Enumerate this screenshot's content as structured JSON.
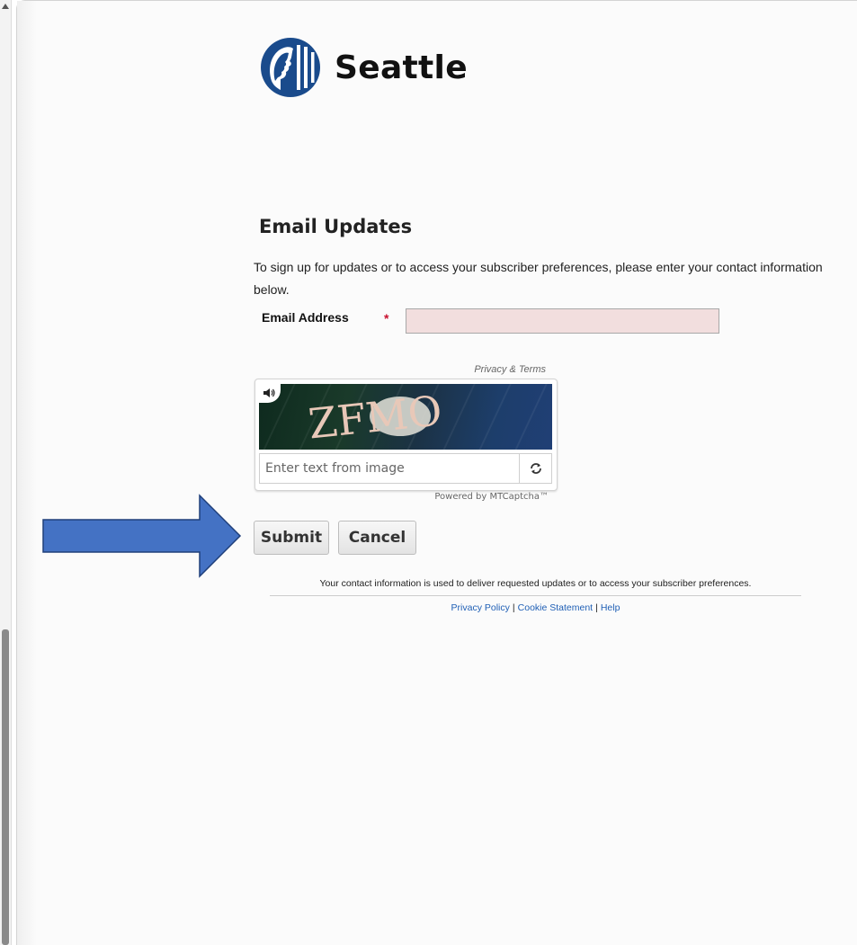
{
  "brand": {
    "name": "Seattle",
    "logo_icon": "seattle-chief-seal-icon",
    "logo_color": "#1a4b8c"
  },
  "page": {
    "title": "Email Updates",
    "intro": "To sign up for updates or to access your subscriber preferences, please enter your contact information below."
  },
  "form": {
    "email_label": "Email Address",
    "required_mark": "*",
    "email_value": "",
    "required_field_bg": "#f2dede"
  },
  "captcha": {
    "privacy_terms": "Privacy & Terms",
    "image_text": "ZFMO",
    "input_placeholder": "Enter text from image",
    "refresh_icon": "refresh-icon",
    "audio_icon": "speaker-icon",
    "powered_by": "Powered by MTCaptcha™"
  },
  "buttons": {
    "submit": "Submit",
    "cancel": "Cancel"
  },
  "annotation": {
    "arrow_color": "#4472c4",
    "arrow_icon": "right-arrow-icon"
  },
  "footer": {
    "note": "Your contact information is used to deliver requested updates or to access your subscriber preferences.",
    "links": [
      "Privacy Policy",
      "Cookie Statement",
      "Help"
    ],
    "separator": "|",
    "link_color": "#1f5fb5"
  }
}
